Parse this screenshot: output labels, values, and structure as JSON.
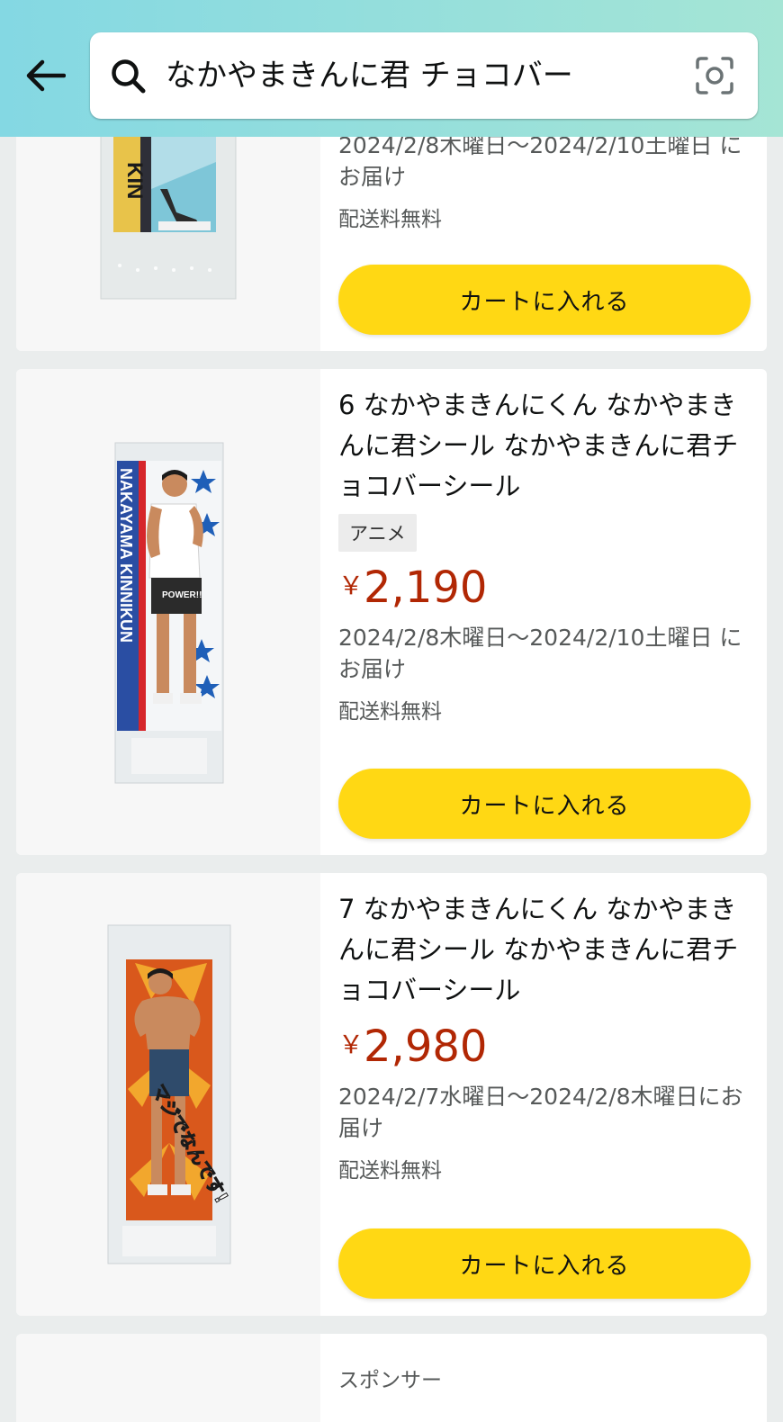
{
  "header": {
    "search_value": "なかやまきんに君 チョコバー"
  },
  "items": [
    {
      "delivery": "2024/2/8木曜日～2024/2/10土曜日 にお届け",
      "shipping": "配送料無料",
      "cart_label": "カートに入れる",
      "wrapper_text": "KIN"
    },
    {
      "title": "6 なかやまきんにくん なかやまきんに君シール なかやまきんに君チョコバーシール",
      "tag": "アニメ",
      "price_symbol": "￥",
      "price": "2,190",
      "delivery": "2024/2/8木曜日～2024/2/10土曜日 にお届け",
      "shipping": "配送料無料",
      "cart_label": "カートに入れる",
      "wrapper_text": "NAKAYAMA KINNIKUN",
      "power_text": "POWER!!"
    },
    {
      "title": "7 なかやまきんにくん なかやまきんに君シール なかやまきんに君チョコバーシール",
      "price_symbol": "￥",
      "price": "2,980",
      "delivery": "2024/2/7水曜日～2024/2/8木曜日にお届け",
      "shipping": "配送料無料",
      "cart_label": "カートに入れる",
      "sticker_text": "マジでなんです!"
    }
  ],
  "sponsored": {
    "label": "スポンサー"
  },
  "colors": {
    "header_gradient_start": "#84d8e3",
    "header_gradient_end": "#a5e5d5",
    "cart_button": "#ffd814",
    "price": "#b12704"
  }
}
